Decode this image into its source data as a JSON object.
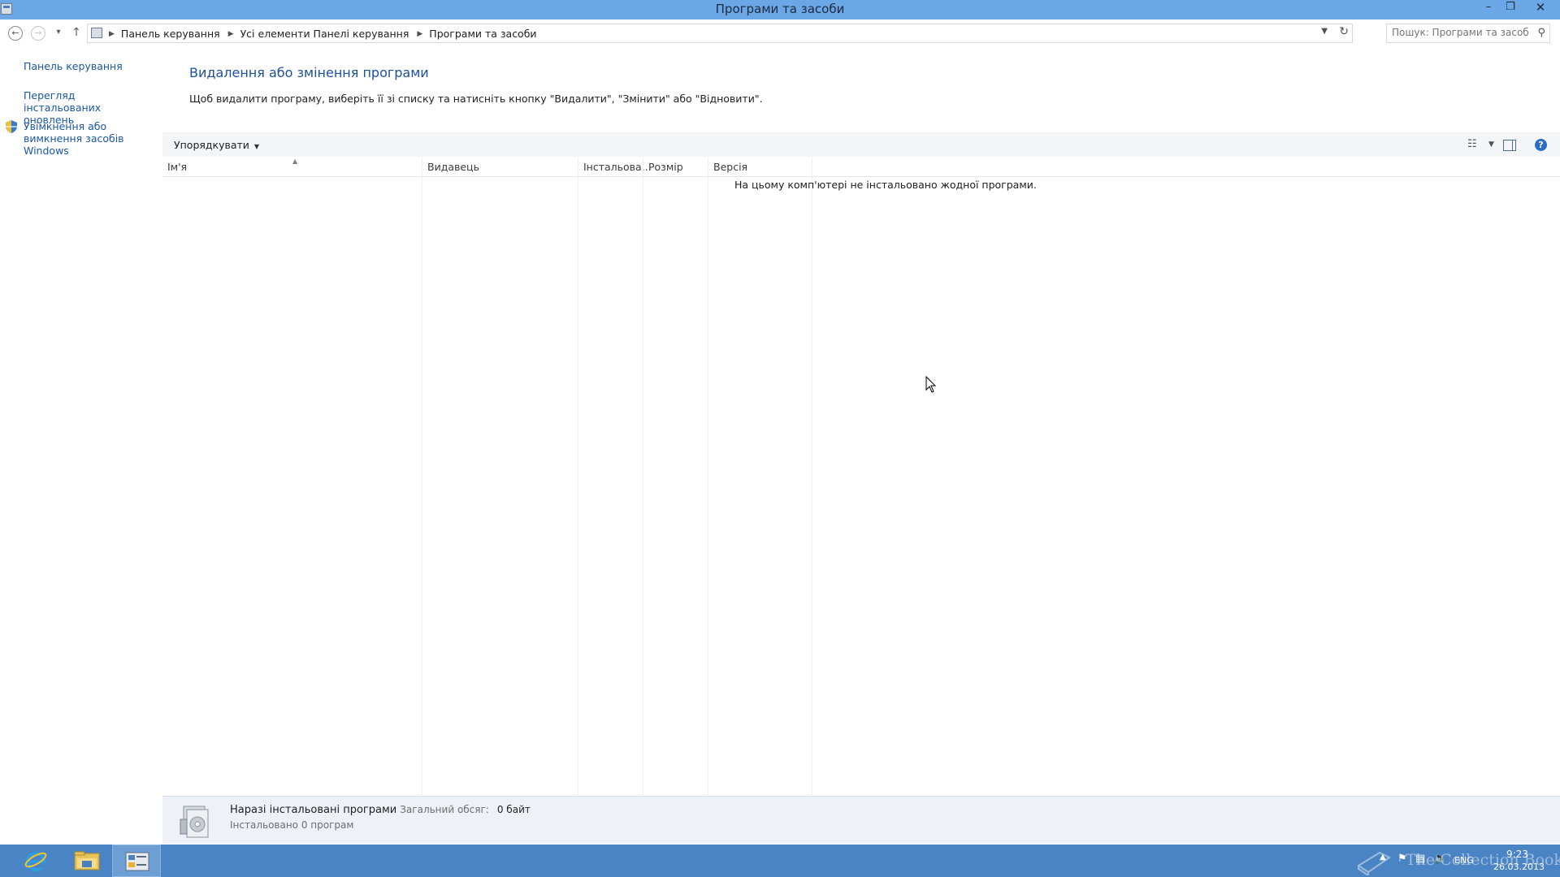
{
  "window": {
    "title": "Програми та засоби",
    "minimize": "–",
    "maximize": "❐",
    "close": "✕"
  },
  "nav": {
    "back": "←",
    "forward": "→",
    "recent": "▾",
    "up": "↑",
    "breadcrumbs": [
      "Панель керування",
      "Усі елементи Панелі керування",
      "Програми та засоби"
    ],
    "search_placeholder": "Пошук: Програми та засоби"
  },
  "sidebar": {
    "items": [
      {
        "label": "Панель керування"
      },
      {
        "label": "Перегляд інстальованих оновлень"
      },
      {
        "label": "Увімкнення або вимкнення засобів Windows"
      }
    ]
  },
  "main": {
    "heading": "Видалення або змінення програми",
    "description": "Щоб видалити програму, виберіть її зі списку та натисніть кнопку \"Видалити\", \"Змінити\" або \"Відновити\"."
  },
  "toolbar": {
    "organize_label": "Упорядкувати"
  },
  "columns": [
    "Ім'я",
    "Видавець",
    "Інстальова...",
    "Розмір",
    "Версія"
  ],
  "list": {
    "empty_message": "На цьому комп'ютері не інстальовано жодної програми."
  },
  "details": {
    "title": "Наразі інстальовані програми",
    "total_label": "Загальний обсяг:",
    "total_value": "0 байт",
    "installed_count": "Інстальовано 0 програм"
  },
  "taskbar": {
    "language": "ENG",
    "time": "9:23",
    "date": "26.03.2013",
    "watermark": "The Collection Book"
  },
  "colors": {
    "titlebar": "#6ba7e6",
    "taskbar": "#4a84c4",
    "link": "#1a56a5",
    "heading": "#1d4f9a"
  }
}
